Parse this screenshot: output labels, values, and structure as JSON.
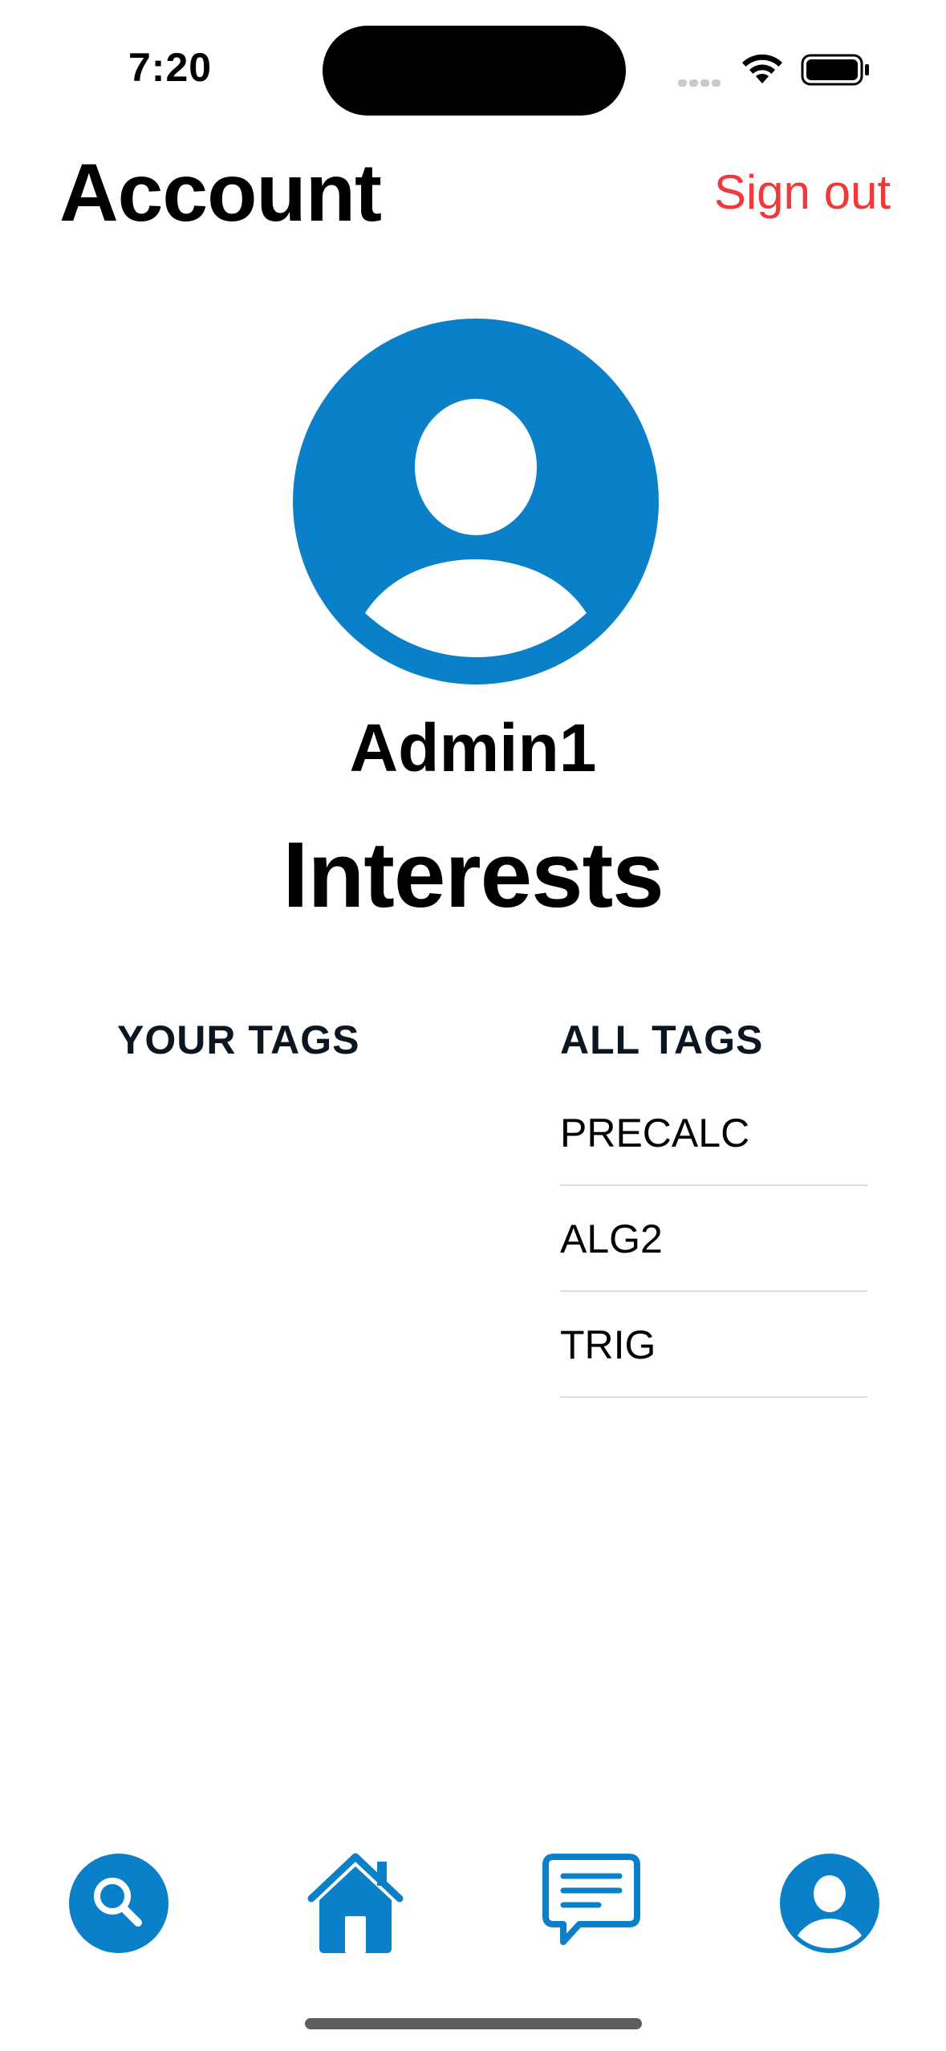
{
  "status_bar": {
    "time": "7:20"
  },
  "header": {
    "title": "Account",
    "sign_out_label": "Sign out"
  },
  "profile": {
    "username": "Admin1"
  },
  "interests": {
    "title": "Interests",
    "your_tags_header": "YOUR TAGS",
    "all_tags_header": "ALL TAGS",
    "your_tags": [],
    "all_tags": [
      "PRECALC",
      "ALG2",
      "TRIG"
    ]
  },
  "tab_bar": {
    "items": [
      {
        "icon": "search-icon"
      },
      {
        "icon": "home-icon"
      },
      {
        "icon": "messages-icon"
      },
      {
        "icon": "account-icon"
      }
    ]
  },
  "colors": {
    "accent": "#0a80c8",
    "destructive": "#f0393a"
  }
}
